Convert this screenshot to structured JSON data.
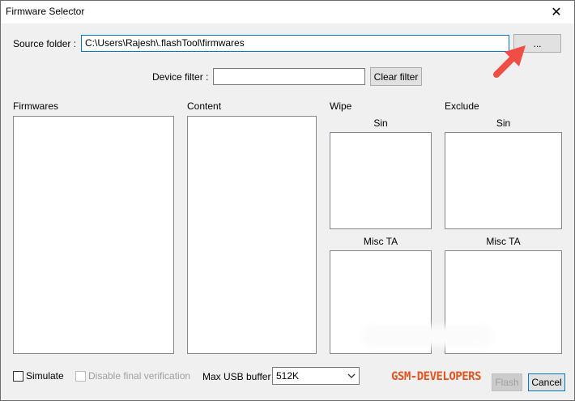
{
  "window": {
    "title": "Firmware Selector",
    "close_glyph": "✕"
  },
  "source": {
    "label": "Source folder :",
    "value": "C:\\Users\\Rajesh\\.flashTool\\firmwares",
    "browse_label": "..."
  },
  "filter": {
    "label": "Device filter :",
    "value": "",
    "clear_label": "Clear filter"
  },
  "sections": {
    "firmwares": "Firmwares",
    "content": "Content",
    "wipe": "Wipe",
    "exclude": "Exclude",
    "wipe_sin": "Sin",
    "wipe_misc": "Misc TA",
    "exclude_sin": "Sin",
    "exclude_misc": "Misc TA"
  },
  "options": {
    "simulate_label": "Simulate",
    "disable_verif_label": "Disable final verification",
    "usb_buffer_label": "Max USB buffer",
    "usb_buffer_value": "512K"
  },
  "actions": {
    "flash_label": "Flash",
    "cancel_label": "Cancel"
  },
  "watermark": "GSM-DEVELOPERS",
  "colors": {
    "arrow": "#f04e45",
    "focus_border": "#0078d7",
    "watermark": "#e7531f"
  }
}
